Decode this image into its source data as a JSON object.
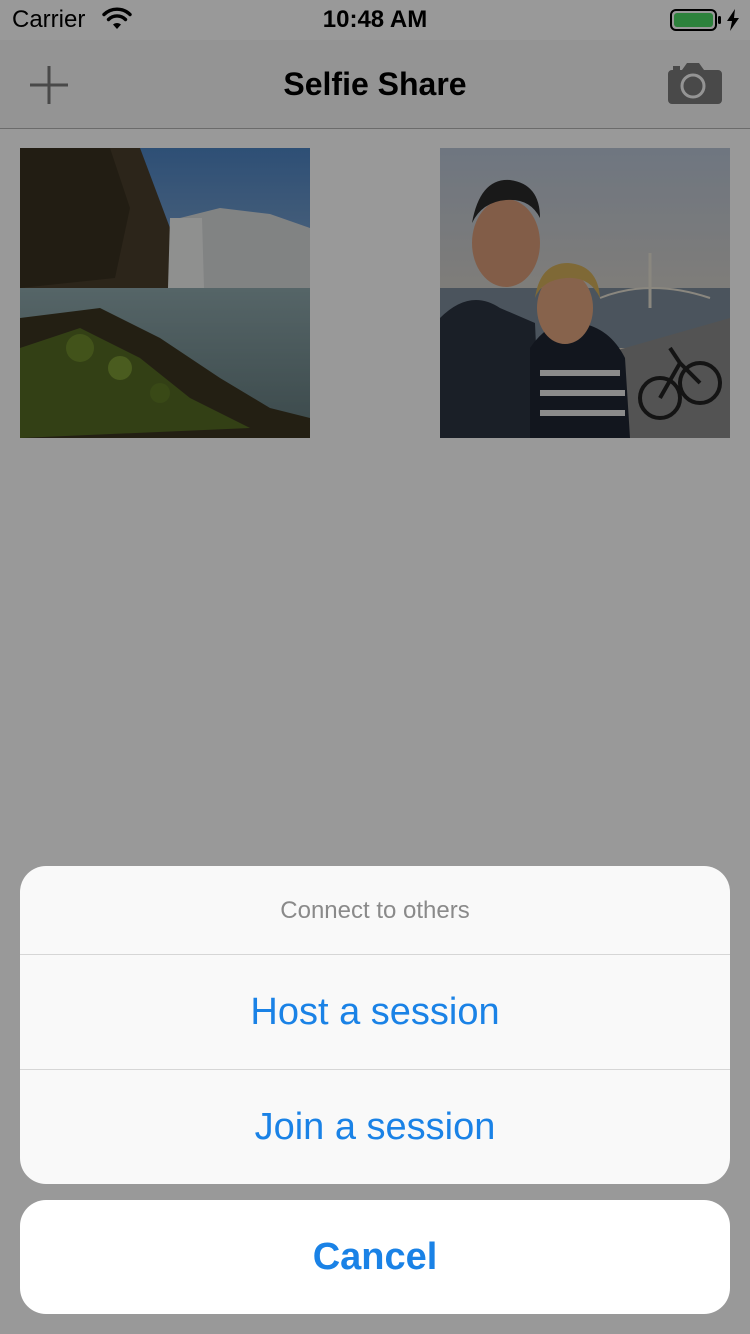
{
  "status_bar": {
    "carrier": "Carrier",
    "time": "10:48 AM",
    "icons": [
      "wifi-icon",
      "battery-icon",
      "charging-bolt-icon"
    ]
  },
  "nav": {
    "title": "Selfie Share",
    "left_icon": "plus-icon",
    "right_icon": "camera-icon"
  },
  "photos": [
    {
      "subject": "waterfall landscape"
    },
    {
      "subject": "couple selfie by river"
    }
  ],
  "action_sheet": {
    "title": "Connect to others",
    "actions": [
      "Host a session",
      "Join a session"
    ],
    "cancel": "Cancel"
  },
  "colors": {
    "accent": "#1a82e6",
    "overlay": "rgba(0,0,0,0.4)",
    "battery": "#4cd964"
  }
}
